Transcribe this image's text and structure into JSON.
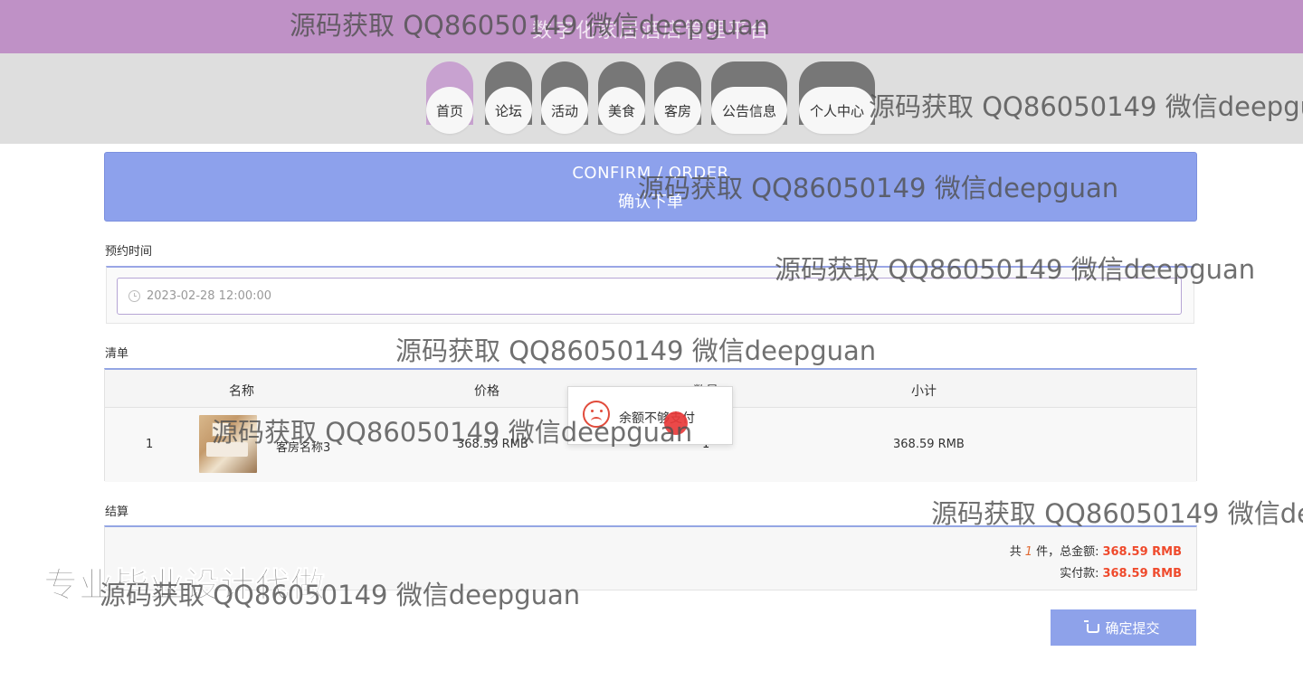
{
  "header": {
    "title": "数字化家居酒店管理平台"
  },
  "nav": {
    "items": [
      {
        "label": "首页"
      },
      {
        "label": "论坛"
      },
      {
        "label": "活动"
      },
      {
        "label": "美食"
      },
      {
        "label": "客房"
      },
      {
        "label": "公告信息"
      },
      {
        "label": "个人中心"
      }
    ]
  },
  "banner": {
    "title_en": "CONFIRM / ORDER",
    "title_cn": "确认下单"
  },
  "appointment": {
    "label": "预约时间",
    "value": "2023-02-28 12:00:00"
  },
  "order_list": {
    "label": "清单",
    "headers": [
      "名称",
      "价格",
      "数量",
      "小计"
    ],
    "rows": [
      {
        "index": "1",
        "name": "客房名称3",
        "price": "368.59 RMB",
        "quantity": "1",
        "subtotal": "368.59 RMB"
      }
    ]
  },
  "toast": {
    "message": "余额不够支付"
  },
  "settlement": {
    "label": "结算",
    "total_prefix": "共",
    "count": "1",
    "total_mid": "件，总金额:",
    "total_amount": "368.59 RMB",
    "paid_label": "实付款:",
    "paid_amount": "368.59 RMB"
  },
  "submit": {
    "label": "确定提交"
  },
  "overlay": {
    "watermark": "源码获取 QQ86050149 微信deepguan",
    "stamp": "专业毕业设计代做"
  },
  "colors": {
    "header_bg": "#bf91c6",
    "accent": "#8da1ec",
    "amount": "#ef4a2c"
  }
}
